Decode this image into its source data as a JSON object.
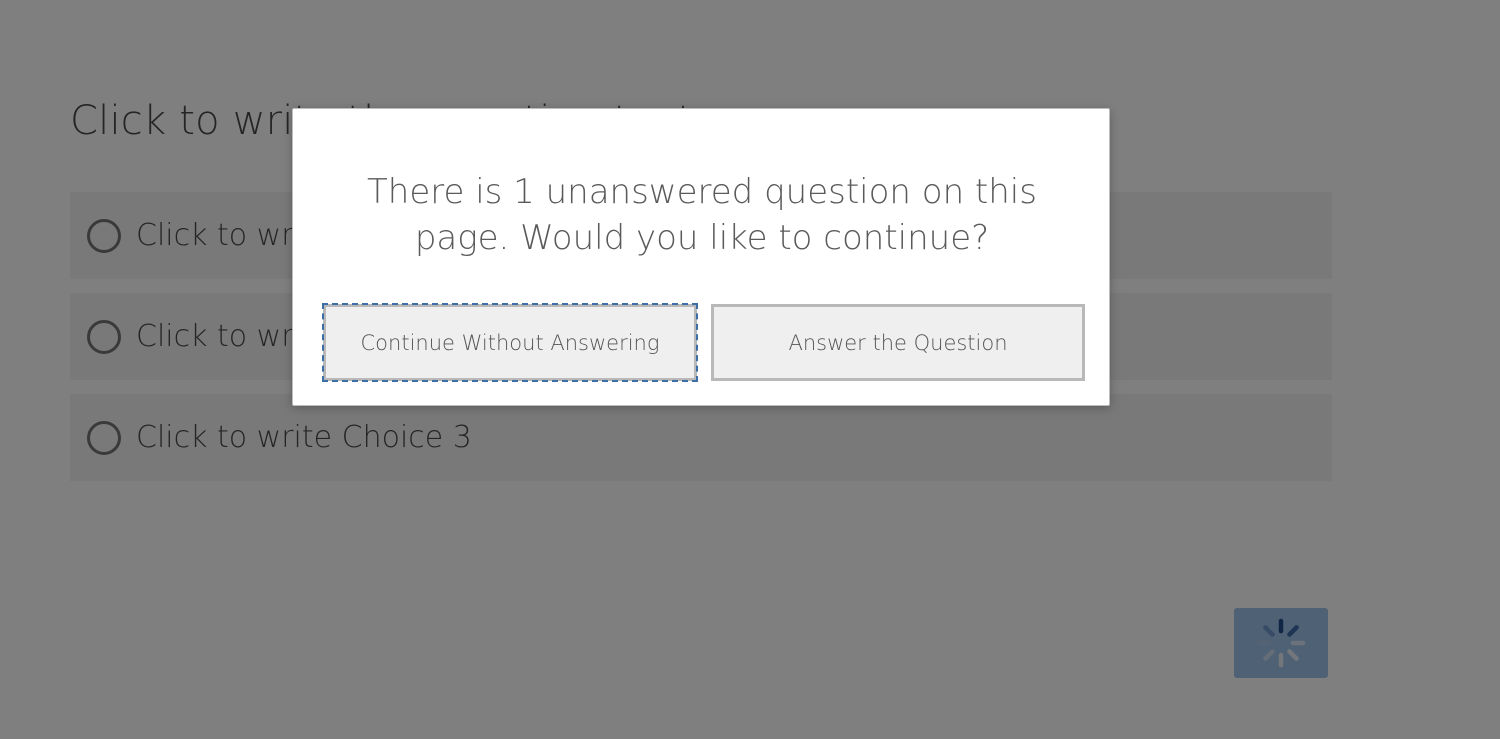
{
  "survey": {
    "question_text": "Click to write the question text",
    "choices": [
      {
        "label": "Click to write Choice 1"
      },
      {
        "label": "Click to write Choice 2"
      },
      {
        "label": "Click to write Choice 3"
      }
    ],
    "next_button": {
      "icon": "loading-spinner-icon"
    }
  },
  "dialog": {
    "message": "There is 1 unanswered question on this page. Would you like to continue?",
    "continue_label": "Continue Without Answering",
    "answer_label": "Answer the Question"
  },
  "colors": {
    "overlay": "rgba(0,0,0,0.5)",
    "next_button": "#9fc2ea",
    "focus_outline": "#3b6fa6"
  }
}
